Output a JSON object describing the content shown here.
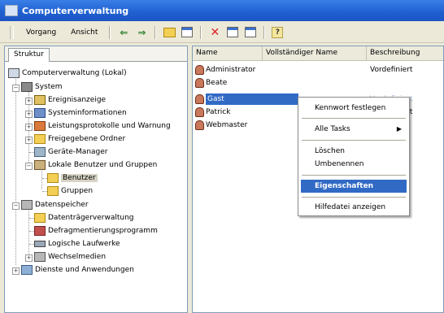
{
  "window": {
    "title": "Computerverwaltung"
  },
  "toolbar": {
    "menus": [
      "Vorgang",
      "Ansicht"
    ]
  },
  "left": {
    "tab": "Struktur",
    "tree": [
      "Computerverwaltung (Lokal)",
      "System",
      "Ereignisanzeige",
      "Systeminformationen",
      "Leistungsprotokolle und Warnung",
      "Freigegebene Ordner",
      "Geräte-Manager",
      "Lokale Benutzer und Gruppen",
      "Benutzer",
      "Gruppen",
      "Datenspeicher",
      "Datenträgerverwaltung",
      "Defragmentierungsprogramm",
      "Logische Laufwerke",
      "Wechselmedien",
      "Dienste und Anwendungen"
    ]
  },
  "list": {
    "columns": [
      "Name",
      "Vollständiger Name",
      "Beschreibung"
    ],
    "rows": [
      {
        "name": "Administrator",
        "full": "",
        "desc": "Vordefiniert"
      },
      {
        "name": "Beate",
        "full": "",
        "desc": ""
      },
      {
        "name": "Gast",
        "full": "",
        "desc": "Vordefiniert"
      },
      {
        "name": "Patrick",
        "full": "",
        "desc": "Vordefiniert"
      },
      {
        "name": "Webmaster",
        "full": "",
        "desc": ""
      }
    ]
  },
  "context_menu": {
    "items": [
      "Kennwort festlegen",
      "Alle Tasks",
      "Löschen",
      "Umbenennen",
      "Eigenschaften",
      "Hilfedatei anzeigen"
    ],
    "highlighted": "Eigenschaften"
  },
  "icons": [
    "back-arrow-icon",
    "forward-arrow-icon",
    "up-folder-icon",
    "console-tree-icon",
    "delete-icon",
    "properties-icon",
    "export-icon",
    "help-icon"
  ]
}
